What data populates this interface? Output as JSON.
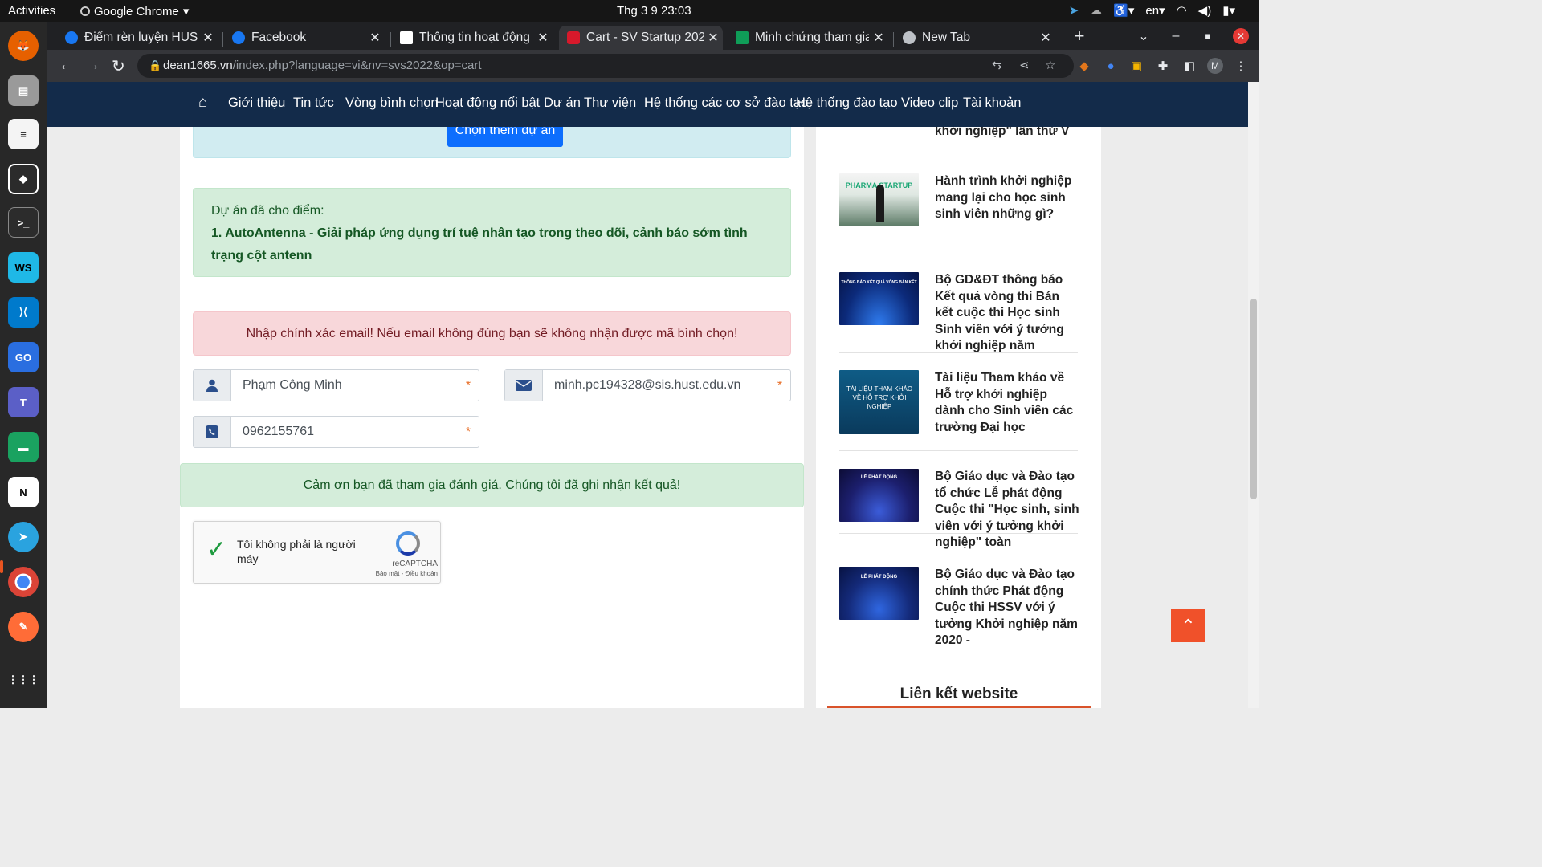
{
  "system": {
    "activities": "Activities",
    "app_name": "Google Chrome",
    "clock": "Thg 3 9  23:03",
    "lang": "en"
  },
  "tabs": [
    {
      "title": "Điểm rèn luyện HUST",
      "favicon": "facebook-icon"
    },
    {
      "title": "Facebook",
      "favicon": "facebook-icon"
    },
    {
      "title": "Thông tin hoạt động",
      "favicon": "hust-icon"
    },
    {
      "title": "Cart - SV Startup 2022",
      "favicon": "mortarboard-icon",
      "active": true
    },
    {
      "title": "Minh chứng tham gia",
      "favicon": "sheets-icon"
    },
    {
      "title": "New Tab",
      "favicon": "chrome-icon"
    }
  ],
  "address": {
    "host": "dean1665.vn",
    "path": "/index.php?language=vi&nv=svs2022&op=cart"
  },
  "profile_initial": "M",
  "nav": [
    "Giới thiệu",
    "Tin tức",
    "Vòng bình chọn",
    "Hoạt động nổi bật",
    "Dự án",
    "Thư viện",
    "Hệ thống các cơ sở đào tạo",
    "Hệ thống đào tạo",
    "Video clip",
    "Tài khoản"
  ],
  "main": {
    "more_button": "Chọn thêm dự án",
    "voted_label": "Dự án đã cho điểm:",
    "voted_project": "1. AutoAntenna - Giải pháp ứng dụng trí tuệ nhân tạo trong theo dõi, cảnh báo sớm tình trạng cột antenn",
    "warning": "Nhập chính xác email! Nếu email không đúng bạn sẽ không nhận được mã bình chọn!",
    "name_value": "Phạm Công Minh",
    "email_value": "minh.pc194328@sis.hust.edu.vn",
    "phone_value": "0962155761",
    "required_mark": "*",
    "thanks": "Cảm ơn bạn đã tham gia đánh giá. Chúng tôi đã ghi nhận kết quả!",
    "captcha_label": "Tôi không phải là người máy",
    "captcha_brand": "reCAPTCHA",
    "captcha_terms": "Bảo mật - Điều khoản"
  },
  "sidebar": {
    "news": [
      {
        "title": "khởi nghiệp\" lần thứ V"
      },
      {
        "title": "Hành trình khởi nghiệp mang lại cho học sinh sinh viên những gì?",
        "thumb_text": "PHARMA STARTUP"
      },
      {
        "title": "Bộ GD&ĐT thông báo Kết quả vòng thi Bán kết cuộc thi Học sinh Sinh viên với ý tưởng khởi nghiệp năm",
        "thumb_text": "THÔNG BÁO KẾT QUẢ VÒNG BÁN KẾT"
      },
      {
        "title": "Tài liệu Tham khảo về Hỗ trợ khởi nghiệp dành cho Sinh viên các trường Đại học",
        "thumb_text": "TÀI LIỆU THAM KHẢO VỀ HỖ TRỢ KHỞI NGHIỆP"
      },
      {
        "title": "Bộ Giáo dục và Đào tạo tổ chức Lễ phát động Cuộc thi \"Học sinh, sinh viên với ý tưởng khởi nghiệp\" toàn",
        "thumb_text": "LỄ PHÁT ĐỘNG"
      },
      {
        "title": "Bộ Giáo dục và Đào tạo chính thức Phát động Cuộc thi HSSV với ý tưởng Khởi nghiệp năm 2020 -",
        "thumb_text": "LỄ PHÁT ĐỘNG"
      }
    ],
    "links_heading": "Liên kết website"
  },
  "colors": {
    "site_nav": "#132b4a",
    "accent_orange": "#f0512a",
    "success_bg": "#d4edda",
    "danger_bg": "#f8d7da",
    "info_bg": "#d1ecf1",
    "primary": "#0d6efd"
  }
}
